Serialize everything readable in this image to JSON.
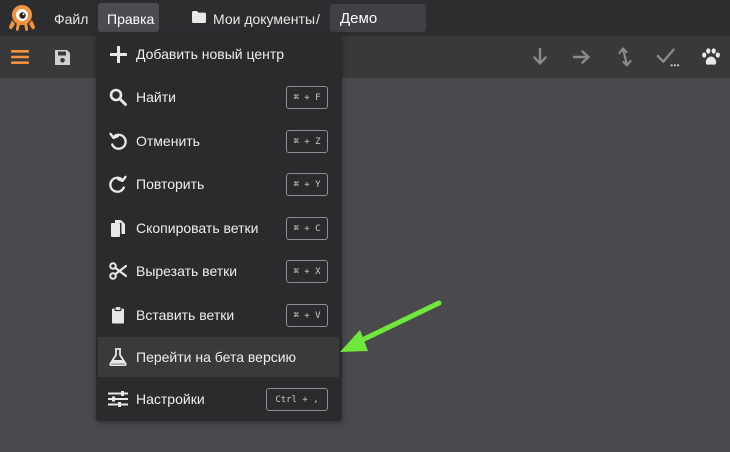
{
  "menubar": {
    "file_label": "Файл",
    "edit_label": "Правка",
    "breadcrumb": "Мои документы",
    "breadcrumb_separator": "/",
    "document_name": "Демо"
  },
  "toolbar": {
    "left_icons": [
      "hamburger-icon",
      "save-icon"
    ],
    "right_icons": [
      "arrow-down-icon",
      "arrow-right-icon",
      "swap-vertical-icon",
      "check-more-icon",
      "paw-icon"
    ],
    "accent_color": "#f5923e"
  },
  "edit_menu": {
    "items": [
      {
        "label": "Добавить новый центр",
        "icon": "plus-icon",
        "shortcut": ""
      },
      {
        "label": "Найти",
        "icon": "search-icon",
        "shortcut": "⌘ + F"
      },
      {
        "label": "Отменить",
        "icon": "undo-icon",
        "shortcut": "⌘ + Z"
      },
      {
        "label": "Повторить",
        "icon": "redo-icon",
        "shortcut": "⌘ + Y"
      },
      {
        "label": "Скопировать ветки",
        "icon": "copy-icon",
        "shortcut": "⌘ + C"
      },
      {
        "label": "Вырезать ветки",
        "icon": "scissors-icon",
        "shortcut": "⌘ + X"
      },
      {
        "label": "Вставить ветки",
        "icon": "clipboard-icon",
        "shortcut": "⌘ + V"
      },
      {
        "label": "Перейти на бета версию",
        "icon": "flask-icon",
        "shortcut": ""
      },
      {
        "label": "Настройки",
        "icon": "sliders-icon",
        "shortcut": "Ctrl + ,"
      }
    ]
  },
  "annotation": {
    "color": "#6ee83a",
    "icon": "green-arrow-pointer"
  }
}
